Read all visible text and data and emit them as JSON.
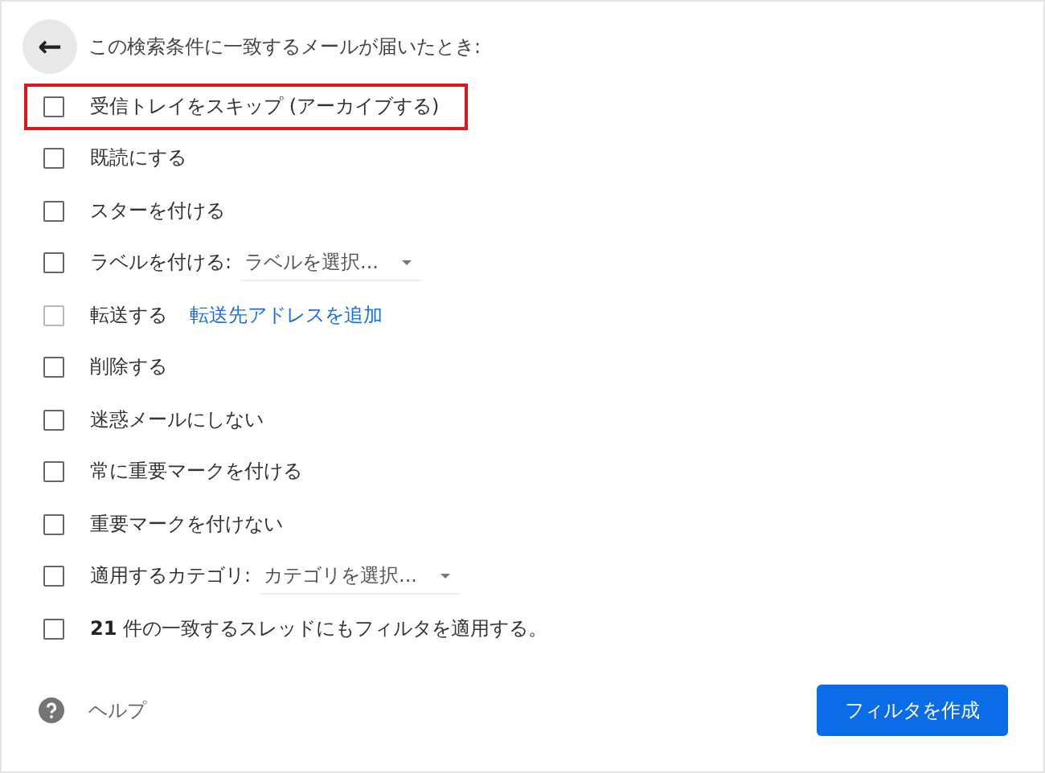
{
  "header": {
    "back_button": "←",
    "title": "この検索条件に一致するメールが届いたとき:"
  },
  "actions": [
    {
      "kind": "plain",
      "label": "受信トレイをスキップ (アーカイブする)",
      "checked": false,
      "disabled": false,
      "highlighted": true
    },
    {
      "kind": "plain",
      "label": "既読にする",
      "checked": false,
      "disabled": false,
      "highlighted": false
    },
    {
      "kind": "plain",
      "label": "スターを付ける",
      "checked": false,
      "disabled": false,
      "highlighted": false
    },
    {
      "kind": "select",
      "label": "ラベルを付ける:",
      "value": "ラベルを選択...",
      "checked": false,
      "disabled": false,
      "highlighted": false
    },
    {
      "kind": "link",
      "label": "転送する",
      "link": "転送先アドレスを追加",
      "checked": false,
      "disabled": true,
      "highlighted": false
    },
    {
      "kind": "plain",
      "label": "削除する",
      "checked": false,
      "disabled": false,
      "highlighted": false
    },
    {
      "kind": "plain",
      "label": "迷惑メールにしない",
      "checked": false,
      "disabled": false,
      "highlighted": false
    },
    {
      "kind": "plain",
      "label": "常に重要マークを付ける",
      "checked": false,
      "disabled": false,
      "highlighted": false
    },
    {
      "kind": "plain",
      "label": "重要マークを付けない",
      "checked": false,
      "disabled": false,
      "highlighted": false
    },
    {
      "kind": "select",
      "label": "適用するカテゴリ:",
      "value": "カテゴリを選択...",
      "checked": false,
      "disabled": false,
      "highlighted": false
    },
    {
      "kind": "plain",
      "label": "**21** 件の一致するスレッドにもフィルタを適用する。",
      "checked": false,
      "disabled": false,
      "highlighted": false
    }
  ],
  "footer": {
    "help": "ヘルプ",
    "create_button": "フィルタを作成"
  }
}
